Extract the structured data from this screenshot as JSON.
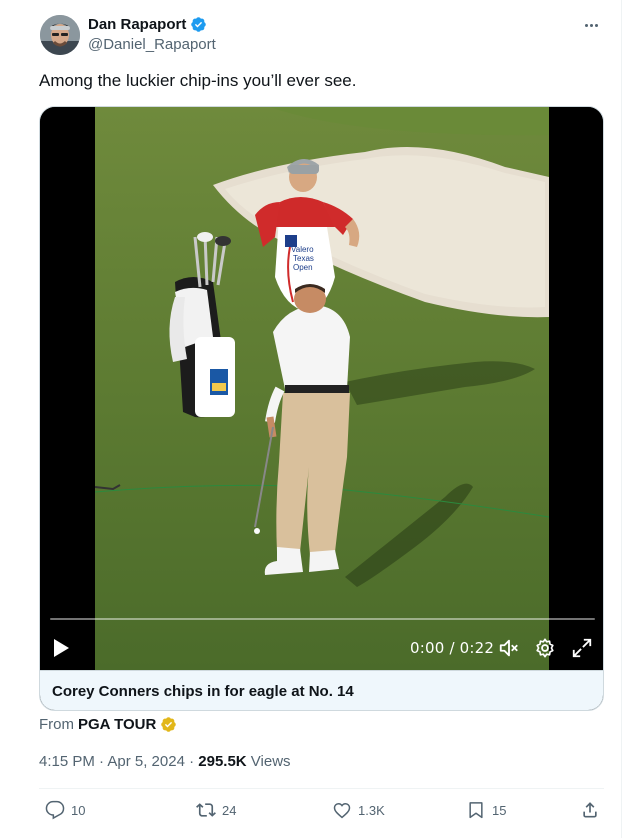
{
  "author": {
    "name": "Dan Rapaport",
    "handle": "@Daniel_Rapaport",
    "verified_color": "#1d9bf0"
  },
  "tweet": {
    "text": "Among the luckier chip-ins you’ll ever see."
  },
  "video": {
    "time": "0:00 / 0:22",
    "caption": "Corey Conners chips in for eagle at No. 14",
    "progress": 0
  },
  "source": {
    "prefix": "From",
    "name": "PGA TOUR",
    "badge_color": "#e2b719"
  },
  "meta": {
    "time_date": "4:15 PM · Apr 5, 2024 · ",
    "views_count": "295.5K",
    "views_label": " Views"
  },
  "actions": {
    "replies": "10",
    "reposts": "24",
    "likes": "1.3K",
    "bookmarks": "15"
  },
  "icons": [
    "more-icon",
    "verified-icon",
    "play-icon",
    "volume-muted-icon",
    "settings-icon",
    "fullscreen-icon",
    "gold-verified-icon",
    "reply-icon",
    "repost-icon",
    "like-icon",
    "bookmark-icon",
    "share-icon"
  ]
}
